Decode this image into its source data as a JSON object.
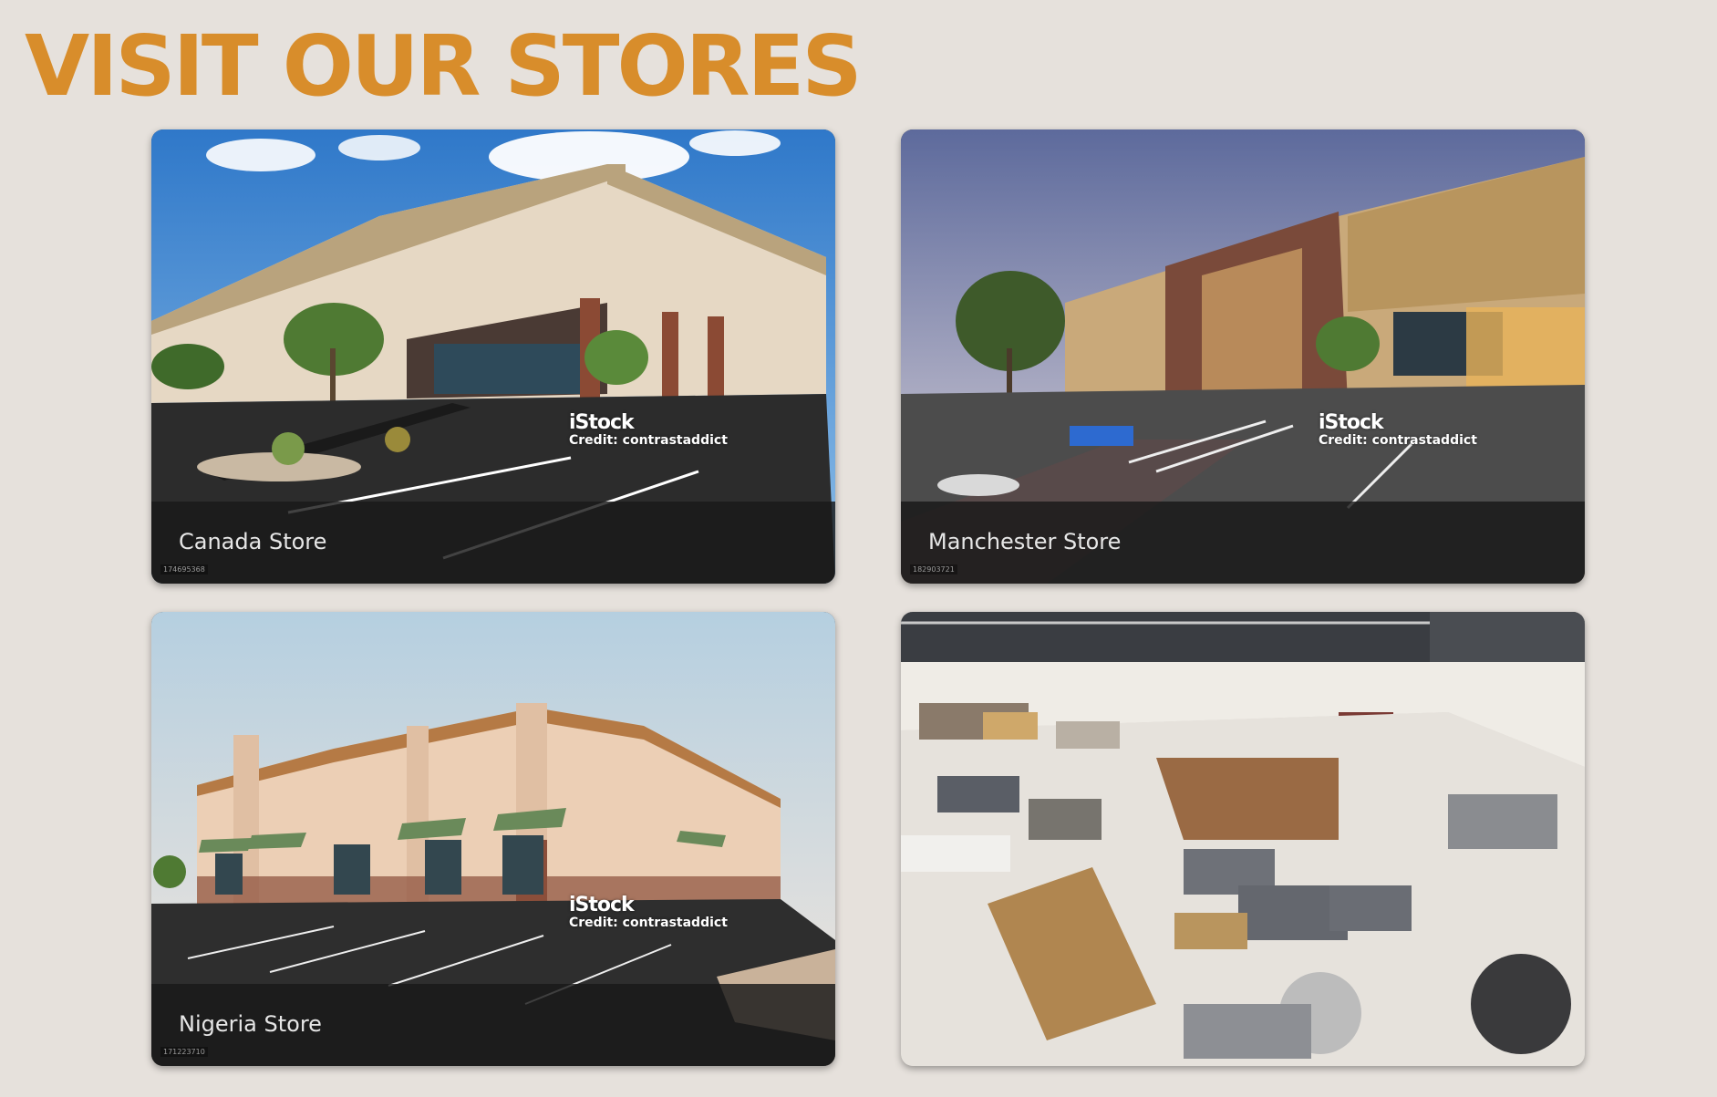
{
  "page": {
    "title": "VISIT OUR STORES"
  },
  "colors": {
    "background": "#e6e1dc",
    "accent": "#d88d2b",
    "caption_band": "#191919",
    "caption_text": "#e6e6e6"
  },
  "stores": [
    {
      "name": "Canada Store",
      "stock_id": "174695368",
      "watermark_brand": "iStock",
      "watermark_credit": "Credit: contrastaddict",
      "photo": "exterior of a beige and brick retail strip building with parking lot and blue sky"
    },
    {
      "name": "Manchester Store",
      "stock_id": "182903721",
      "watermark_brand": "iStock",
      "watermark_credit": "Credit: contrastaddict",
      "photo": "exterior of brown and tan commercial building at dusk with accessible parking space"
    },
    {
      "name": "Nigeria Store",
      "stock_id": "171223710",
      "watermark_brand": "iStock",
      "watermark_credit": "Credit: contrastaddict",
      "photo": "exterior of peach colored strip mall with green awnings and empty parking lot"
    },
    {
      "name": "",
      "photo": "interior of a warehouse furniture showroom with sofas, tables and a wooden reception desk"
    }
  ]
}
